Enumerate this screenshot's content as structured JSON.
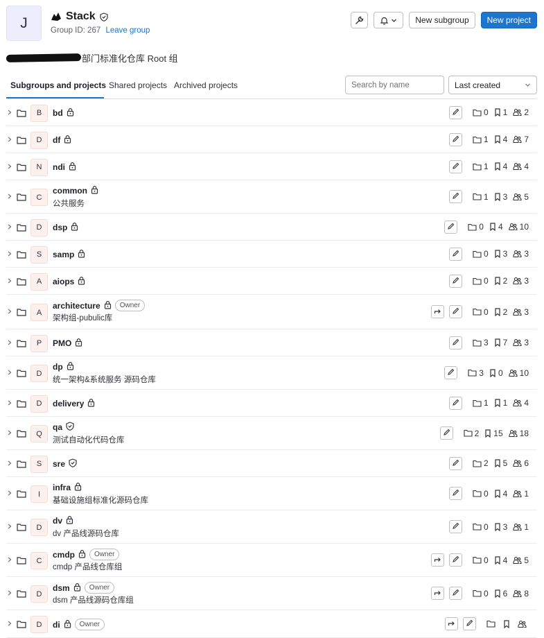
{
  "group": {
    "avatar_letter": "J",
    "name": "Stack",
    "group_id": "Group ID: 267",
    "leave_label": "Leave group",
    "description": "部门标准化仓库 Root 组"
  },
  "header_actions": {
    "new_subgroup": "New subgroup",
    "new_project": "New project"
  },
  "tabs": {
    "subgroups": "Subgroups and projects",
    "shared": "Shared projects",
    "archived": "Archived projects"
  },
  "search": {
    "placeholder": "Search by name"
  },
  "sort": {
    "selected": "Last created"
  },
  "colors": {
    "primary": "#1f75cb",
    "avatar_bg": "#fcf1ef"
  },
  "items": [
    {
      "letter": "B",
      "name": "bd",
      "desc": "",
      "lock": "lock",
      "owner": "",
      "share": false,
      "groups": "0",
      "projects": "1",
      "members": "2"
    },
    {
      "letter": "D",
      "name": "df",
      "desc": "",
      "lock": "lock",
      "owner": "",
      "share": false,
      "groups": "1",
      "projects": "4",
      "members": "7"
    },
    {
      "letter": "N",
      "name": "ndi",
      "desc": "",
      "lock": "lock",
      "owner": "",
      "share": false,
      "groups": "1",
      "projects": "4",
      "members": "4"
    },
    {
      "letter": "C",
      "name": "common",
      "desc": "公共服务",
      "lock": "lock",
      "owner": "",
      "share": false,
      "groups": "1",
      "projects": "3",
      "members": "5"
    },
    {
      "letter": "D",
      "name": "dsp",
      "desc": "",
      "lock": "lock",
      "owner": "",
      "share": false,
      "groups": "0",
      "projects": "4",
      "members": "10"
    },
    {
      "letter": "S",
      "name": "samp",
      "desc": "",
      "lock": "lock",
      "owner": "",
      "share": false,
      "groups": "0",
      "projects": "3",
      "members": "3"
    },
    {
      "letter": "A",
      "name": "aiops",
      "desc": "",
      "lock": "lock",
      "owner": "",
      "share": false,
      "groups": "0",
      "projects": "2",
      "members": "3"
    },
    {
      "letter": "A",
      "name": "architecture",
      "desc": "架构组-pubulic库",
      "lock": "lock",
      "owner": "Owner",
      "share": true,
      "groups": "0",
      "projects": "2",
      "members": "3"
    },
    {
      "letter": "P",
      "name": "PMO",
      "desc": "",
      "lock": "lock",
      "owner": "",
      "share": false,
      "groups": "3",
      "projects": "7",
      "members": "3"
    },
    {
      "letter": "D",
      "name": "dp",
      "desc": "统一架构&系统服务 源码仓库",
      "lock": "lock",
      "owner": "",
      "share": false,
      "groups": "3",
      "projects": "0",
      "members": "10"
    },
    {
      "letter": "D",
      "name": "delivery",
      "desc": "",
      "lock": "lock",
      "owner": "",
      "share": false,
      "groups": "1",
      "projects": "1",
      "members": "4"
    },
    {
      "letter": "Q",
      "name": "qa",
      "desc": "测试自动化代码仓库",
      "lock": "shield",
      "owner": "",
      "share": false,
      "groups": "2",
      "projects": "15",
      "members": "18"
    },
    {
      "letter": "S",
      "name": "sre",
      "desc": "",
      "lock": "shield",
      "owner": "",
      "share": false,
      "groups": "2",
      "projects": "5",
      "members": "6"
    },
    {
      "letter": "I",
      "name": "infra",
      "desc": "基础设施组标准化源码仓库",
      "lock": "lock",
      "owner": "",
      "share": false,
      "groups": "0",
      "projects": "4",
      "members": "1"
    },
    {
      "letter": "D",
      "name": "dv",
      "desc": "dv 产品线源码仓库",
      "lock": "lock",
      "owner": "",
      "share": false,
      "groups": "0",
      "projects": "3",
      "members": "1"
    },
    {
      "letter": "C",
      "name": "cmdp",
      "desc": "cmdp 产品线仓库组",
      "lock": "lock",
      "owner": "Owner",
      "share": true,
      "groups": "0",
      "projects": "4",
      "members": "5"
    },
    {
      "letter": "D",
      "name": "dsm",
      "desc": "dsm 产品线源码仓库组",
      "lock": "lock",
      "owner": "Owner",
      "share": true,
      "groups": "0",
      "projects": "6",
      "members": "8"
    },
    {
      "letter": "D",
      "name": "di",
      "desc": "",
      "lock": "lock",
      "owner": "Owner",
      "share": true,
      "groups": "",
      "projects": "",
      "members": ""
    }
  ]
}
